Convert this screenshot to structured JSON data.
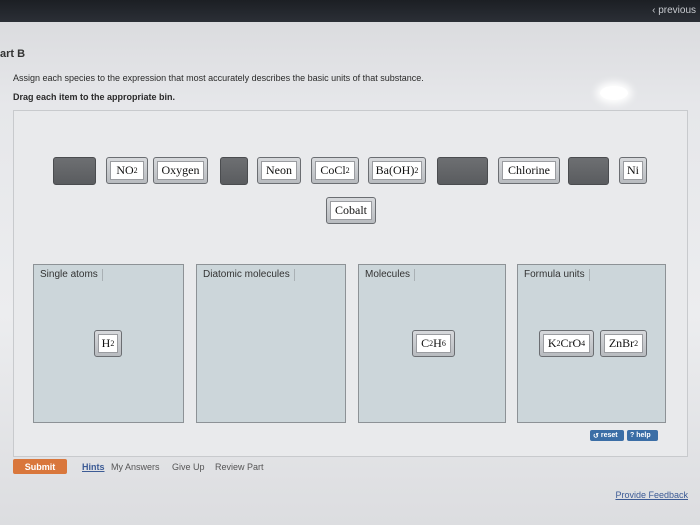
{
  "nav": {
    "previous_label": "‹ previous"
  },
  "part": {
    "title": "art B",
    "instruction": "Assign each species to the expression that most accurately describes the basic units of that substance.",
    "drag_instruction": "Drag each item to the appropriate bin."
  },
  "items_bank": [
    {
      "kind": "placeholder"
    },
    {
      "kind": "item",
      "text": "NO",
      "sub": "2"
    },
    {
      "kind": "item",
      "text": "Oxygen",
      "sub": ""
    },
    {
      "kind": "placeholder"
    },
    {
      "kind": "item",
      "text": "Neon",
      "sub": ""
    },
    {
      "kind": "item",
      "text": "CoCl",
      "sub": "2"
    },
    {
      "kind": "item",
      "text": "Ba(OH)",
      "sub": "2"
    },
    {
      "kind": "placeholder"
    },
    {
      "kind": "item",
      "text": "Chlorine",
      "sub": ""
    },
    {
      "kind": "placeholder"
    },
    {
      "kind": "item",
      "text": "Ni",
      "sub": ""
    },
    {
      "kind": "item",
      "text": "Cobalt",
      "sub": ""
    }
  ],
  "bins": [
    {
      "label": "Single atoms",
      "items": [
        {
          "text": "H",
          "sub": "2"
        }
      ]
    },
    {
      "label": "Diatomic molecules",
      "items": []
    },
    {
      "label": "Molecules",
      "items": [
        {
          "text": "C",
          "sub": "2",
          "text2": "H",
          "sub2": "6"
        }
      ]
    },
    {
      "label": "Formula units",
      "items": [
        {
          "text": "K",
          "sub": "2",
          "text2": "CrO",
          "sub2": "4"
        },
        {
          "text": "ZnBr",
          "sub": "2"
        }
      ]
    }
  ],
  "controls": {
    "reset_label": "reset",
    "help_label": "? help"
  },
  "footer": {
    "submit_label": "Submit",
    "hints_label": "Hints",
    "my_answers_label": "My Answers",
    "give_up_label": "Give Up",
    "review_part_label": "Review Part",
    "feedback_label": "Provide Feedback"
  },
  "colors": {
    "submit": "#d9773c",
    "bin_bg": "#ccd6da",
    "placeholder": "#5f6164",
    "link": "#3c5b95"
  }
}
